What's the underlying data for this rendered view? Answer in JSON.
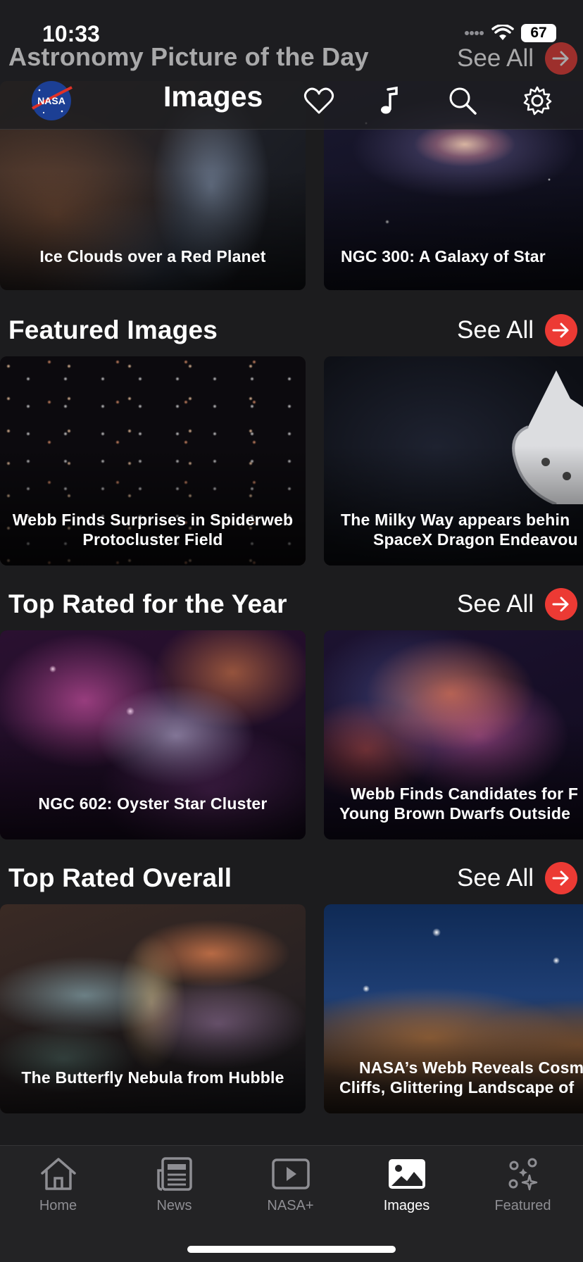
{
  "status_bar": {
    "time": "10:33",
    "battery": "67"
  },
  "header": {
    "apod_title": "Astronomy Picture of the Day",
    "apod_see_all": "See All",
    "nav_title": "Images",
    "logo_text": "NASA",
    "icons": [
      "nasa-logo",
      "heart-icon",
      "music-note-icon",
      "search-icon",
      "gear-icon"
    ]
  },
  "apod_cards": [
    {
      "caption": "Ice Clouds over a Red Planet"
    },
    {
      "caption": "NGC 300: A Galaxy of Star"
    }
  ],
  "sections": [
    {
      "title": "Featured Images",
      "see_all": "See All",
      "cards": [
        {
          "line1": "Webb Finds Surprises in Spiderweb",
          "line2": "Protocluster Field"
        },
        {
          "line1": "The Milky Way appears behin",
          "line2": "SpaceX Dragon Endeavou"
        }
      ]
    },
    {
      "title": "Top Rated for the Year",
      "see_all": "See All",
      "cards": [
        {
          "line1": "NGC 602: Oyster Star Cluster"
        },
        {
          "line1": "Webb Finds Candidates for F",
          "line2": "Young Brown Dwarfs Outside"
        }
      ]
    },
    {
      "title": "Top Rated Overall",
      "see_all": "See All",
      "cards": [
        {
          "line1": "The Butterfly Nebula from Hubble"
        },
        {
          "line1": "NASA’s Webb Reveals Cosm",
          "line2": "Cliffs, Glittering Landscape of"
        }
      ]
    }
  ],
  "tabs": [
    {
      "label": "Home",
      "icon": "house-icon"
    },
    {
      "label": "News",
      "icon": "newspaper-icon"
    },
    {
      "label": "NASA+",
      "icon": "play-icon"
    },
    {
      "label": "Images",
      "icon": "photo-icon",
      "active": true
    },
    {
      "label": "Featured",
      "icon": "sparkles-icon"
    }
  ],
  "colors": {
    "accent": "#ec3a34",
    "background": "#1c1c1e",
    "tabbar": "#232325",
    "inactive": "#8e8e93"
  }
}
